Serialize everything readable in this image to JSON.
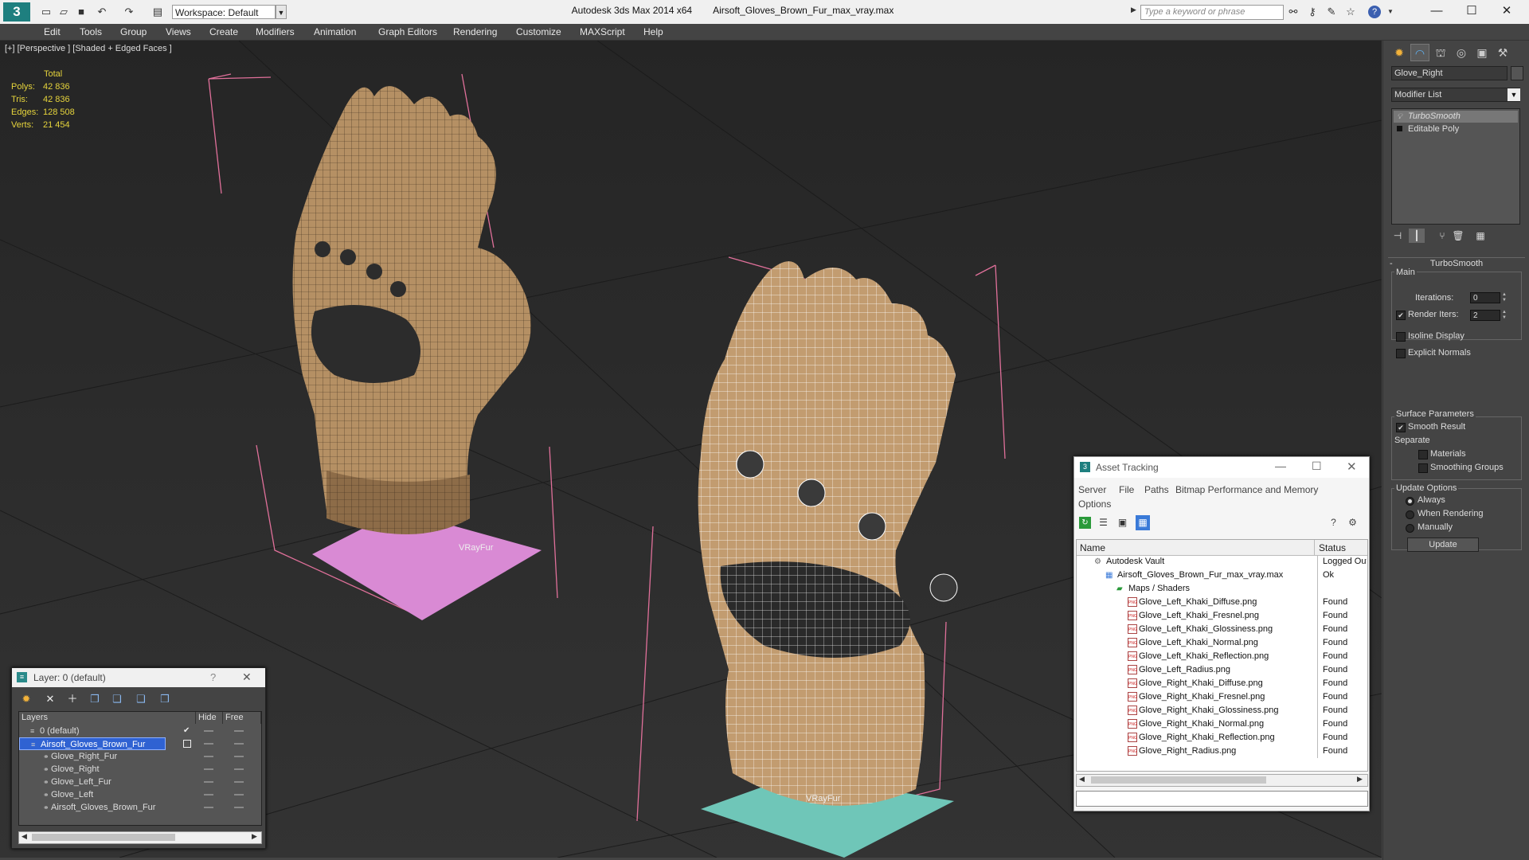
{
  "titlebar": {
    "logo": "3",
    "workspace": "Workspace: Default",
    "app_name": "Autodesk 3ds Max  2014 x64",
    "file_name": "Airsoft_Gloves_Brown_Fur_max_vray.max",
    "search_placeholder": "Type a keyword or phrase"
  },
  "menu": [
    "Edit",
    "Tools",
    "Group",
    "Views",
    "Create",
    "Modifiers",
    "Animation",
    "Graph Editors",
    "Rendering",
    "Customize",
    "MAXScript",
    "Help"
  ],
  "viewport": {
    "label": "[+] [Perspective ] [Shaded + Edged Faces ]",
    "stats_header": "Total",
    "stats": [
      {
        "label": "Polys:",
        "value": "42 836"
      },
      {
        "label": "Tris:",
        "value": "42 836"
      },
      {
        "label": "Edges:",
        "value": "128 508"
      },
      {
        "label": "Verts:",
        "value": "21 454"
      }
    ],
    "fur_label_left": "VRayFur",
    "fur_label_right": "VRayFur"
  },
  "command_panel": {
    "object_name": "Glove_Right",
    "modifier_list": "Modifier List",
    "stack": [
      "TurboSmooth",
      "Editable Poly"
    ],
    "rollout_title": "TurboSmooth",
    "main_label": "Main",
    "iterations_label": "Iterations:",
    "iterations_value": "0",
    "render_iters_label": "Render Iters:",
    "render_iters_value": "2",
    "isoline_label": "Isoline Display",
    "explicit_normals_label": "Explicit Normals",
    "surface_params_label": "Surface Parameters",
    "smooth_result_label": "Smooth Result",
    "separate_label": "Separate",
    "materials_label": "Materials",
    "smoothing_groups_label": "Smoothing Groups",
    "update_options_label": "Update Options",
    "always_label": "Always",
    "when_rendering_label": "When Rendering",
    "manually_label": "Manually",
    "update_button": "Update"
  },
  "layer_window": {
    "title": "Layer: 0 (default)",
    "help": "?",
    "col_layers": "Layers",
    "col_hide": "Hide",
    "col_freeze": "Free",
    "rows": [
      {
        "name": "0 (default)",
        "indent": 1
      },
      {
        "name": "Airsoft_Gloves_Brown_Fur",
        "indent": 1,
        "selected": true
      },
      {
        "name": "Glove_Right_Fur",
        "indent": 2
      },
      {
        "name": "Glove_Right",
        "indent": 2
      },
      {
        "name": "Glove_Left_Fur",
        "indent": 2
      },
      {
        "name": "Glove_Left",
        "indent": 2
      },
      {
        "name": "Airsoft_Gloves_Brown_Fur",
        "indent": 2
      }
    ]
  },
  "asset_tracking": {
    "title": "Asset Tracking",
    "menu": [
      "Server",
      "File",
      "Paths",
      "Bitmap Performance and Memory"
    ],
    "menu2": "Options",
    "col_name": "Name",
    "col_status": "Status",
    "rows": [
      {
        "name": "Autodesk Vault",
        "status": "Logged Out",
        "indent": 1,
        "icon": "vault"
      },
      {
        "name": "Airsoft_Gloves_Brown_Fur_max_vray.max",
        "status": "Ok",
        "indent": 2,
        "icon": "max"
      },
      {
        "name": "Maps / Shaders",
        "status": "",
        "indent": 3,
        "icon": "folder"
      },
      {
        "name": "Glove_Left_Khaki_Diffuse.png",
        "status": "Found",
        "indent": 4,
        "icon": "png"
      },
      {
        "name": "Glove_Left_Khaki_Fresnel.png",
        "status": "Found",
        "indent": 4,
        "icon": "png"
      },
      {
        "name": "Glove_Left_Khaki_Glossiness.png",
        "status": "Found",
        "indent": 4,
        "icon": "png"
      },
      {
        "name": "Glove_Left_Khaki_Normal.png",
        "status": "Found",
        "indent": 4,
        "icon": "png"
      },
      {
        "name": "Glove_Left_Khaki_Reflection.png",
        "status": "Found",
        "indent": 4,
        "icon": "png"
      },
      {
        "name": "Glove_Left_Radius.png",
        "status": "Found",
        "indent": 4,
        "icon": "png"
      },
      {
        "name": "Glove_Right_Khaki_Diffuse.png",
        "status": "Found",
        "indent": 4,
        "icon": "png"
      },
      {
        "name": "Glove_Right_Khaki_Fresnel.png",
        "status": "Found",
        "indent": 4,
        "icon": "png"
      },
      {
        "name": "Glove_Right_Khaki_Glossiness.png",
        "status": "Found",
        "indent": 4,
        "icon": "png"
      },
      {
        "name": "Glove_Right_Khaki_Normal.png",
        "status": "Found",
        "indent": 4,
        "icon": "png"
      },
      {
        "name": "Glove_Right_Khaki_Reflection.png",
        "status": "Found",
        "indent": 4,
        "icon": "png"
      },
      {
        "name": "Glove_Right_Radius.png",
        "status": "Found",
        "indent": 4,
        "icon": "png"
      }
    ]
  },
  "colors": {
    "viewport_bg": "#2b2b2b",
    "stats_text": "#e6d43c",
    "selection": "#2f62d2",
    "fur_plane_left": "#d98ad4",
    "fur_plane_right": "#6fc6b8",
    "bbox_line": "#e0709a"
  }
}
